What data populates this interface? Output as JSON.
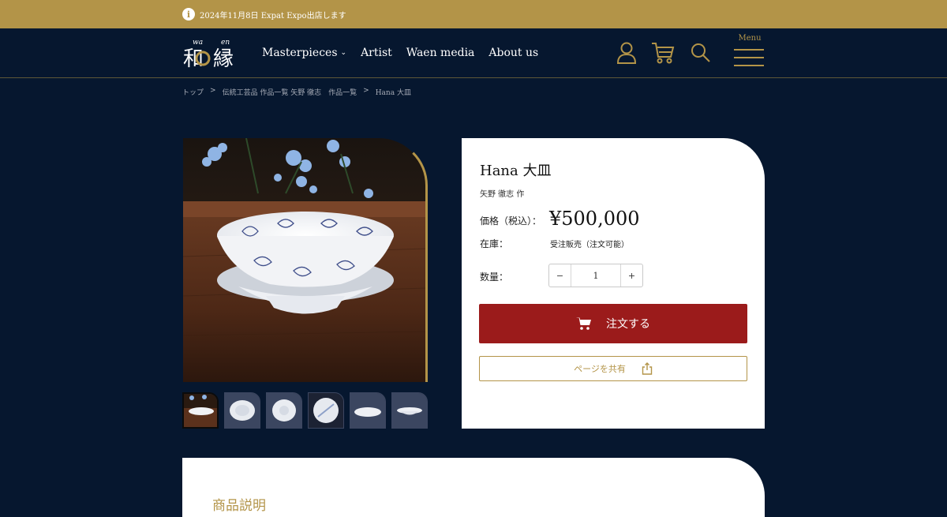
{
  "announcement": {
    "icon": "info-icon",
    "text": "2024年11月8日 Expat Expo出店します"
  },
  "header": {
    "logo_alt_top": "wa   en",
    "nav": [
      {
        "label": "Masterpieces",
        "has_dropdown": true
      },
      {
        "label": "Artist"
      },
      {
        "label": "Waen media"
      },
      {
        "label": "About us"
      }
    ],
    "menu_label": "Menu",
    "icons": [
      "account-icon",
      "cart-icon",
      "search-icon"
    ]
  },
  "breadcrumb": [
    "トップ",
    ">",
    "伝統工芸品 作品一覧 矢野 徹志　作品一覧",
    ">",
    "Hana 大皿"
  ],
  "product": {
    "title": "Hana 大皿",
    "artist": "矢野 徹志 作",
    "price_label": "価格（税込）：",
    "price": "¥500,000",
    "stock_label": "在庫：",
    "stock_value": "受注販売（注文可能）",
    "qty_label": "数量：",
    "qty_minus": "−",
    "qty_value": "1",
    "qty_plus": "+",
    "order_label": "注文する",
    "share_label": "ページを共有",
    "thumbnail_count": 6
  },
  "description": {
    "heading": "商品説明"
  },
  "colors": {
    "background": "#06172f",
    "gold": "#b39448",
    "order_red": "#9b1b1b"
  }
}
